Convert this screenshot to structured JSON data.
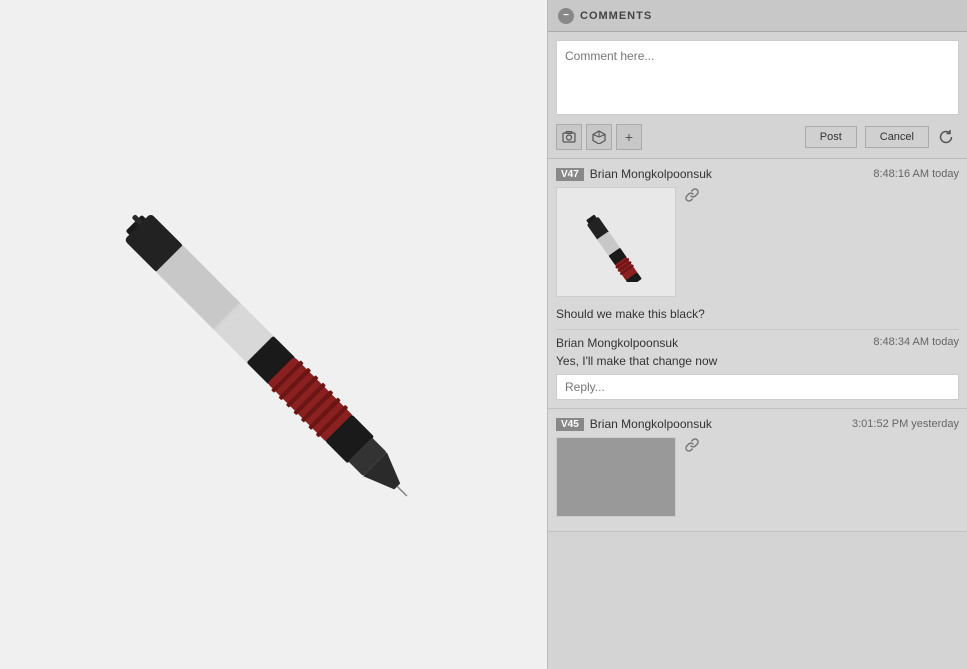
{
  "panel": {
    "header_title": "COMMENTS",
    "minimize_icon": "−"
  },
  "comment_input": {
    "placeholder": "Comment here...",
    "post_label": "Post",
    "cancel_label": "Cancel",
    "photo_icon": "📷",
    "cube_icon": "⬡",
    "plus_icon": "+",
    "refresh_icon": "↺"
  },
  "comments": [
    {
      "version": "V47",
      "author": "Brian Mongkolpoonsuk",
      "time": "8:48:16 AM today",
      "has_thumbnail": true,
      "link_icon": "🔗",
      "text": "Should we make this black?",
      "replies": [
        {
          "author": "Brian Mongkolpoonsuk",
          "time": "8:48:34 AM today",
          "text": "Yes, I'll make that change now"
        }
      ],
      "reply_placeholder": "Reply..."
    },
    {
      "version": "V45",
      "author": "Brian Mongkolpoonsuk",
      "time": "3:01:52 PM yesterday",
      "has_thumbnail": true,
      "link_icon": "🔗",
      "text": ""
    }
  ]
}
